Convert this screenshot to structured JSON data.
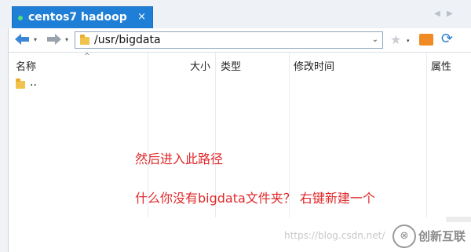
{
  "tab": {
    "title": "centos7 hadoop",
    "close": "×"
  },
  "tab_nav": {
    "prev": "◀",
    "next": "▶"
  },
  "toolbar": {
    "back_icon": "arrow-left-icon",
    "forward_icon": "arrow-right-icon",
    "dropdown_glyph": "▾",
    "path": "/usr/bigdata",
    "path_dropdown": "⌄",
    "bookmark_icon": "star-icon",
    "home_icon": "home-icon",
    "refresh_icon": "refresh-icon"
  },
  "columns": [
    {
      "label": "名称"
    },
    {
      "label": "大小"
    },
    {
      "label": "类型"
    },
    {
      "label": "修改时间"
    },
    {
      "label": "属性"
    }
  ],
  "sort_indicator": "^",
  "files": [
    {
      "name": "..",
      "icon": "folder-icon"
    }
  ],
  "annotations": [
    "然后进入此路径",
    "什么你没有bigdata文件夹？ 右键新建一个"
  ],
  "watermark": {
    "url": "https://blog.csdn.net/",
    "logo_glyph": "⊗",
    "brand": "创新互联"
  },
  "colors": {
    "tab_active": "#1f7ed6",
    "annotation": "#e0282a",
    "folder": "#f1c24c"
  }
}
